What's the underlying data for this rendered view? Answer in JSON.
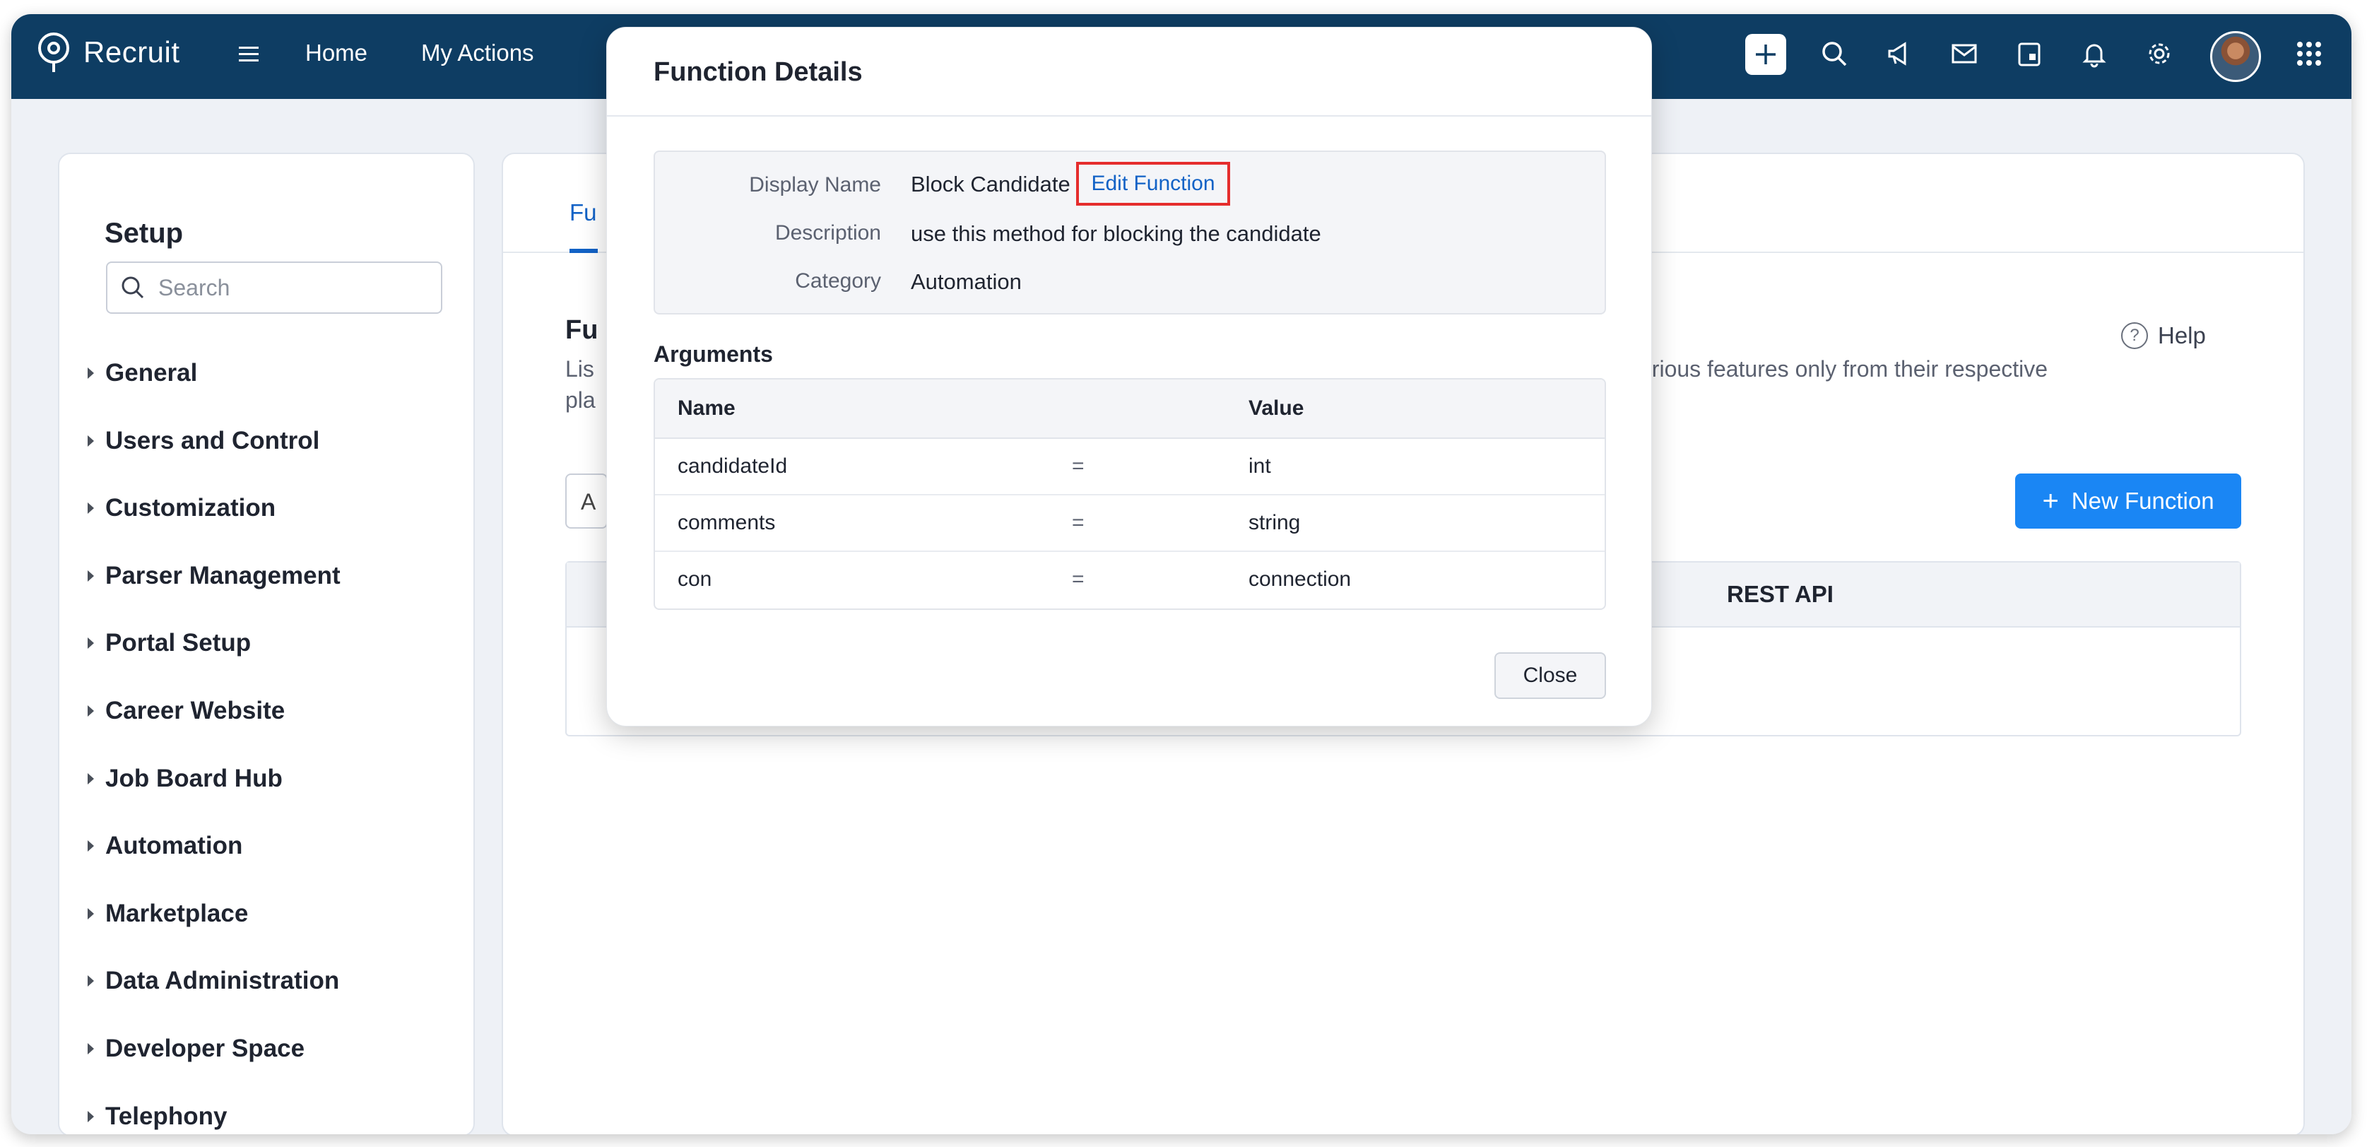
{
  "app": {
    "brand": "Recruit"
  },
  "nav": {
    "items": [
      "Home",
      "My Actions"
    ],
    "right_icons": [
      "plus-icon",
      "search-icon",
      "megaphone-icon",
      "mail-icon",
      "calendar-icon",
      "bell-icon",
      "gear-icon",
      "avatar",
      "apps-grid-icon"
    ]
  },
  "sidebar": {
    "title": "Setup",
    "search_placeholder": "Search",
    "items": [
      "General",
      "Users and Control",
      "Customization",
      "Parser Management",
      "Portal Setup",
      "Career Website",
      "Job Board Hub",
      "Automation",
      "Marketplace",
      "Data Administration",
      "Developer Space",
      "Telephony"
    ]
  },
  "main": {
    "tab_active": "Fu",
    "title": "Fu",
    "desc_line1": "Lis",
    "desc_line2": "pla",
    "desc_right": "arious features only from their respective",
    "help": "Help",
    "filter_value": "A",
    "new_function_label": "New Function",
    "table_header_rest_api": "REST API"
  },
  "modal": {
    "title": "Function Details",
    "display_name_label": "Display Name",
    "display_name_value": "Block Candidate",
    "edit_function_label": "Edit Function",
    "description_label": "Description",
    "description_value": "use this method for blocking the candidate",
    "category_label": "Category",
    "category_value": "Automation",
    "arguments_title": "Arguments",
    "args_header": {
      "name": "Name",
      "value": "Value"
    },
    "args": [
      {
        "name": "candidateId",
        "eq": "=",
        "value": "int"
      },
      {
        "name": "comments",
        "eq": "=",
        "value": "string"
      },
      {
        "name": "con",
        "eq": "=",
        "value": "connection"
      }
    ],
    "close_label": "Close"
  },
  "colors": {
    "nav_bg": "#0e3d63",
    "accent_blue": "#1a86f4",
    "link_blue": "#1262c6",
    "highlight_red": "#e52d2d"
  }
}
